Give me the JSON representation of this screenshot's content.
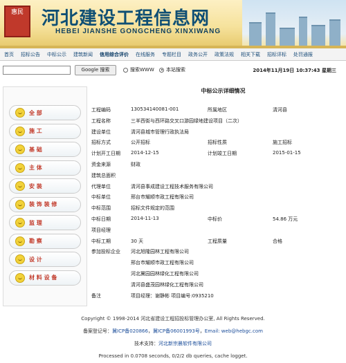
{
  "header": {
    "seal_text": "惠民",
    "title": "河北建设工程信息网",
    "subtitle": "HEBEI JIANSHE GONGCHENG XINXIWANG"
  },
  "nav": [
    "首页",
    "招标公告",
    "中标公示",
    "建筑新闻",
    "信用综合评价",
    "在线服务",
    "专题栏目",
    "政务公开",
    "政策法规",
    "相关下载",
    "招标评标",
    "处罚通报"
  ],
  "nav_active_index": 4,
  "search": {
    "value": "",
    "button": "Google 搜索",
    "option_web": "搜索WWW",
    "option_site": "本站搜索",
    "selected": "site",
    "datetime": "2014年11月19日   10:37:43 星期三"
  },
  "sidebar": [
    "全 部",
    "施 工",
    "基 础",
    "主 体",
    "安 装",
    "装 饰 装 修",
    "监 理",
    "勘 察",
    "设 计",
    "材 料 设 备"
  ],
  "detail": {
    "heading": "中标公示详细情况",
    "rows": [
      {
        "c1": "工程编码",
        "c2": "130534140081-001",
        "c3": "所属地区",
        "c4": "清河县"
      },
      {
        "c1": "工程名称",
        "c2": "三羊西街与西环路交叉口游园绿地建设项目（二次）",
        "c3": "",
        "c4": ""
      },
      {
        "c1": "建设单位",
        "c2": "清河县城市管理行政执法局",
        "c3": "",
        "c4": ""
      },
      {
        "c1": "招标方式",
        "c2": "公开招标",
        "c3": "招标性质",
        "c4": "施工招标"
      },
      {
        "c1": "计划开工日期",
        "c2": "2014-12-15",
        "c3": "计划竣工日期",
        "c4": "2015-01-15"
      },
      {
        "c1": "资金来源",
        "c2": "财政",
        "c3": "",
        "c4": ""
      },
      {
        "c1": "建筑总面积",
        "c2": "",
        "c3": "",
        "c4": ""
      },
      {
        "c1": "代理单位",
        "c2": "清河县事成建设工程技术服务有限公司",
        "c3": "",
        "c4": ""
      },
      {
        "c1": "中标单位",
        "c2": "邢台市耀顺市政工程有限公司",
        "c3": "",
        "c4": ""
      },
      {
        "c1": "中标范围",
        "c2": "招标文件规定的范围",
        "c3": "",
        "c4": ""
      },
      {
        "c1": "中标日期",
        "c2": "2014-11-13",
        "c3": "中标价",
        "c4": "54.86 万元"
      },
      {
        "c1": "项目经理",
        "c2": "",
        "c3": "",
        "c4": ""
      },
      {
        "c1": "中标工期",
        "c2": "30 天",
        "c3": "工程质量",
        "c4": "合格"
      },
      {
        "c1": "参加投标企业",
        "c2": "河北旭隆园林工程有限公司",
        "c3": "",
        "c4": ""
      },
      {
        "c1": "",
        "c2": "邢台市耀顺市政工程有限公司",
        "c3": "",
        "c4": ""
      },
      {
        "c1": "",
        "c2": "河北冀园园林绿化工程有限公司",
        "c3": "",
        "c4": ""
      },
      {
        "c1": "",
        "c2": "清河县盛茂园林绿化工程有限公司",
        "c3": "",
        "c4": ""
      },
      {
        "c1": "备注",
        "c2": "项目经理：谢静彬  项目编号:0935210",
        "c3": "",
        "c4": ""
      }
    ]
  },
  "footer": {
    "copyright": "Copyright © 1998-2014 河北省建设工程招投标管理办公室, All Rights Reserved.",
    "icp_label": "备案登记号：",
    "icp1": "冀ICP备020866",
    "icp2": "冀ICP备06001993号",
    "email": "Email: web@hebgc.com",
    "tech_label": "技术支持：",
    "tech_company": "河北新宗晨软件有限公司",
    "processed": "Processed in 0.0708 seconds, 0/2/2 db queries, cache logget."
  }
}
